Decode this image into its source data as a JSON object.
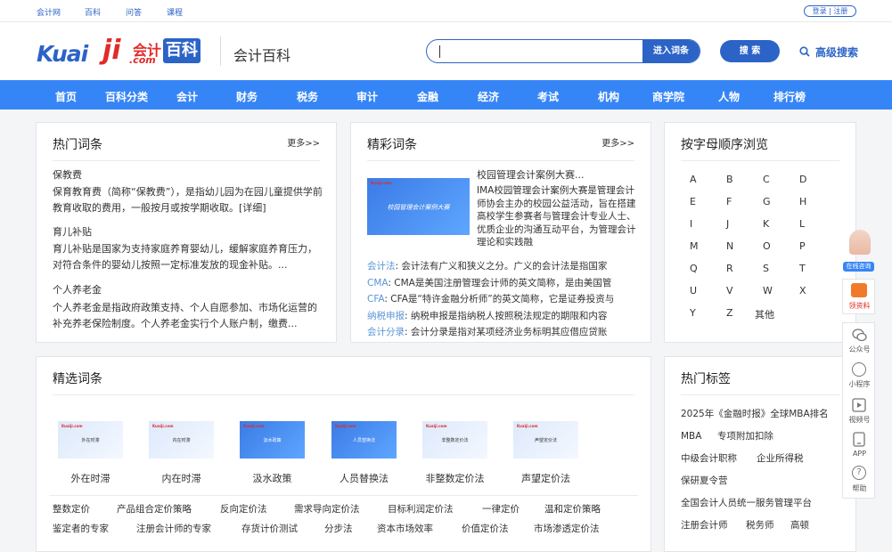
{
  "topbar": {
    "links": [
      "会计网",
      "百科",
      "问答",
      "课程"
    ],
    "login": "登录 | 注册"
  },
  "header": {
    "logo_kuai": "Kuai",
    "logo_ji": "ji",
    "logo_kj": "会计",
    "logo_com": ".com",
    "logo_bk": "百科",
    "title": "会计百科",
    "search_placeholder": "",
    "enter_btn": "进入词条",
    "search_btn": "搜 索",
    "advanced": "高级搜索"
  },
  "nav": [
    "首页",
    "百科分类",
    "会计",
    "财务",
    "税务",
    "审计",
    "金融",
    "经济",
    "考试",
    "机构",
    "商学院",
    "人物",
    "排行榜"
  ],
  "hot": {
    "title": "热门词条",
    "more": "更多>>",
    "items": [
      {
        "name": "保教费",
        "desc": "保育教育费（简称“保教费”），是指幼儿园为在园儿童提供学前教育收取的费用，一般按月或按学期收取。[详细]"
      },
      {
        "name": "育儿补贴",
        "desc": "育儿补贴是国家为支持家庭养育婴幼儿，缓解家庭养育压力，对符合条件的婴幼儿按照一定标准发放的现金补贴。..."
      },
      {
        "name": "个人养老金",
        "desc": "个人养老金是指政府政策支持、个人自愿参加、市场化运营的补充养老保险制度。个人养老金实行个人账户制，缴费..."
      }
    ]
  },
  "featured": {
    "title": "精彩词条",
    "more": "更多>>",
    "top_name": "校园管理会计案例大赛...",
    "thumb_caption": "校园管理会计案例大赛",
    "thumb_logo": "Kuaiji.com",
    "top_desc": "IMA校园管理会计案例大赛是管理会计师协会主办的校园公益活动，旨在搭建高校学生参赛者与管理会计专业人士、优质企业的沟通互动平台，为管理会计理论和实践融",
    "lines": [
      {
        "k": "会计法",
        "v": ": 会计法有广义和狭义之分。广义的会计法是指国家"
      },
      {
        "k": "CMA",
        "v": ": CMA是美国注册管理会计师的英文简称，是由美国管"
      },
      {
        "k": "CFA",
        "v": ": CFA是“特许金融分析师”的英文简称，它是证券投资与"
      },
      {
        "k": "纳税申报",
        "v": ": 纳税申报是指纳税人按照税法规定的期限和内容"
      },
      {
        "k": "会计分录",
        "v": ": 会计分录是指对某项经济业务标明其应借应贷账"
      }
    ]
  },
  "alpha": {
    "title": "按字母顺序浏览",
    "letters": [
      "A",
      "B",
      "C",
      "D",
      "E",
      "F",
      "G",
      "H",
      "I",
      "J",
      "K",
      "L",
      "M",
      "N",
      "O",
      "P",
      "Q",
      "R",
      "S",
      "T",
      "U",
      "V",
      "W",
      "X",
      "Y",
      "Z",
      "其他"
    ]
  },
  "selected": {
    "title": "精选词条",
    "logo": "Kuaiji.com",
    "items": [
      {
        "label": "外在时滞",
        "cap": "外在时滞",
        "dark": false
      },
      {
        "label": "内在时滞",
        "cap": "内在时滞",
        "dark": false
      },
      {
        "label": "汲水政策",
        "cap": "汲水政策",
        "dark": true
      },
      {
        "label": "人员替换法",
        "cap": "人员替换法",
        "dark": true
      },
      {
        "label": "非整数定价法",
        "cap": "非整数定价法",
        "dark": false
      },
      {
        "label": "声望定价法",
        "cap": "声望定价法",
        "dark": false
      }
    ],
    "row1": [
      "整数定价",
      "产品组合定价策略",
      "反向定价法",
      "需求导向定价法",
      "目标利润定价法",
      "一律定价",
      "温和定价策略"
    ],
    "row2": [
      "鉴定者的专家",
      "注册会计师的专家",
      "存货计价测试",
      "分步法",
      "资本市场效率",
      "价值定价法",
      "市场渗透定价法"
    ]
  },
  "tags": {
    "title": "热门标签",
    "rows": [
      [
        "2025年《金融时报》全球MBA排名"
      ],
      [
        "MBA",
        "专项附加扣除"
      ],
      [
        "中级会计职称",
        "企业所得税"
      ],
      [
        "保研夏令营"
      ],
      [
        "全国会计人员统一服务管理平台"
      ],
      [
        "注册会计师",
        "税务师",
        "高顿"
      ]
    ]
  },
  "side": {
    "service": "在线咨询",
    "ziliao": "领资料",
    "items": [
      "公众号",
      "小程序",
      "视频号",
      "APP",
      "帮助"
    ]
  }
}
